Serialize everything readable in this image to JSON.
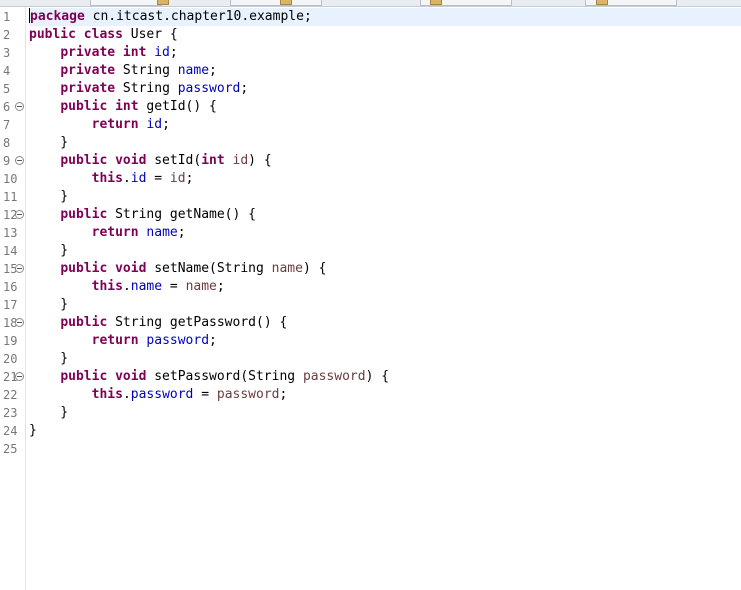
{
  "editor": {
    "lines": [
      {
        "n": "1",
        "fold": false,
        "tokens": [
          {
            "t": "package",
            "k": "kw"
          },
          {
            "t": " cn.itcast.chapter10.example;",
            "k": ""
          }
        ]
      },
      {
        "n": "2",
        "fold": false,
        "tokens": [
          {
            "t": "public class",
            "k": "kw"
          },
          {
            "t": " User {",
            "k": ""
          }
        ]
      },
      {
        "n": "3",
        "fold": false,
        "tokens": [
          {
            "t": "    ",
            "k": ""
          },
          {
            "t": "private int",
            "k": "kw"
          },
          {
            "t": " ",
            "k": ""
          },
          {
            "t": "id",
            "k": "fld"
          },
          {
            "t": ";",
            "k": ""
          }
        ]
      },
      {
        "n": "4",
        "fold": false,
        "tokens": [
          {
            "t": "    ",
            "k": ""
          },
          {
            "t": "private",
            "k": "kw"
          },
          {
            "t": " String ",
            "k": ""
          },
          {
            "t": "name",
            "k": "fld"
          },
          {
            "t": ";",
            "k": ""
          }
        ]
      },
      {
        "n": "5",
        "fold": false,
        "tokens": [
          {
            "t": "    ",
            "k": ""
          },
          {
            "t": "private",
            "k": "kw"
          },
          {
            "t": " String ",
            "k": ""
          },
          {
            "t": "password",
            "k": "fld"
          },
          {
            "t": ";",
            "k": ""
          }
        ]
      },
      {
        "n": "6",
        "fold": true,
        "tokens": [
          {
            "t": "    ",
            "k": ""
          },
          {
            "t": "public int",
            "k": "kw"
          },
          {
            "t": " getId() {",
            "k": ""
          }
        ]
      },
      {
        "n": "7",
        "fold": false,
        "tokens": [
          {
            "t": "        ",
            "k": ""
          },
          {
            "t": "return",
            "k": "kw"
          },
          {
            "t": " ",
            "k": ""
          },
          {
            "t": "id",
            "k": "fld"
          },
          {
            "t": ";",
            "k": ""
          }
        ]
      },
      {
        "n": "8",
        "fold": false,
        "tokens": [
          {
            "t": "    }",
            "k": ""
          }
        ]
      },
      {
        "n": "9",
        "fold": true,
        "tokens": [
          {
            "t": "    ",
            "k": ""
          },
          {
            "t": "public void",
            "k": "kw"
          },
          {
            "t": " setId(",
            "k": ""
          },
          {
            "t": "int",
            "k": "kw"
          },
          {
            "t": " ",
            "k": ""
          },
          {
            "t": "id",
            "k": "prm"
          },
          {
            "t": ") {",
            "k": ""
          }
        ]
      },
      {
        "n": "10",
        "fold": false,
        "tokens": [
          {
            "t": "        ",
            "k": ""
          },
          {
            "t": "this",
            "k": "kw"
          },
          {
            "t": ".",
            "k": ""
          },
          {
            "t": "id",
            "k": "fld"
          },
          {
            "t": " = ",
            "k": ""
          },
          {
            "t": "id",
            "k": "prm"
          },
          {
            "t": ";",
            "k": ""
          }
        ]
      },
      {
        "n": "11",
        "fold": false,
        "tokens": [
          {
            "t": "    }",
            "k": ""
          }
        ]
      },
      {
        "n": "12",
        "fold": true,
        "tokens": [
          {
            "t": "    ",
            "k": ""
          },
          {
            "t": "public",
            "k": "kw"
          },
          {
            "t": " String getName() {",
            "k": ""
          }
        ]
      },
      {
        "n": "13",
        "fold": false,
        "tokens": [
          {
            "t": "        ",
            "k": ""
          },
          {
            "t": "return",
            "k": "kw"
          },
          {
            "t": " ",
            "k": ""
          },
          {
            "t": "name",
            "k": "fld"
          },
          {
            "t": ";",
            "k": ""
          }
        ]
      },
      {
        "n": "14",
        "fold": false,
        "tokens": [
          {
            "t": "    }",
            "k": ""
          }
        ]
      },
      {
        "n": "15",
        "fold": true,
        "tokens": [
          {
            "t": "    ",
            "k": ""
          },
          {
            "t": "public void",
            "k": "kw"
          },
          {
            "t": " setName(String ",
            "k": ""
          },
          {
            "t": "name",
            "k": "prm"
          },
          {
            "t": ") {",
            "k": ""
          }
        ]
      },
      {
        "n": "16",
        "fold": false,
        "tokens": [
          {
            "t": "        ",
            "k": ""
          },
          {
            "t": "this",
            "k": "kw"
          },
          {
            "t": ".",
            "k": ""
          },
          {
            "t": "name",
            "k": "fld"
          },
          {
            "t": " = ",
            "k": ""
          },
          {
            "t": "name",
            "k": "prm"
          },
          {
            "t": ";",
            "k": ""
          }
        ]
      },
      {
        "n": "17",
        "fold": false,
        "tokens": [
          {
            "t": "    }",
            "k": ""
          }
        ]
      },
      {
        "n": "18",
        "fold": true,
        "tokens": [
          {
            "t": "    ",
            "k": ""
          },
          {
            "t": "public",
            "k": "kw"
          },
          {
            "t": " String getPassword() {",
            "k": ""
          }
        ]
      },
      {
        "n": "19",
        "fold": false,
        "tokens": [
          {
            "t": "        ",
            "k": ""
          },
          {
            "t": "return",
            "k": "kw"
          },
          {
            "t": " ",
            "k": ""
          },
          {
            "t": "password",
            "k": "fld"
          },
          {
            "t": ";",
            "k": ""
          }
        ]
      },
      {
        "n": "20",
        "fold": false,
        "tokens": [
          {
            "t": "    }",
            "k": ""
          }
        ]
      },
      {
        "n": "21",
        "fold": true,
        "tokens": [
          {
            "t": "    ",
            "k": ""
          },
          {
            "t": "public void",
            "k": "kw"
          },
          {
            "t": " setPassword(String ",
            "k": ""
          },
          {
            "t": "password",
            "k": "prm"
          },
          {
            "t": ") {",
            "k": ""
          }
        ]
      },
      {
        "n": "22",
        "fold": false,
        "tokens": [
          {
            "t": "        ",
            "k": ""
          },
          {
            "t": "this",
            "k": "kw"
          },
          {
            "t": ".",
            "k": ""
          },
          {
            "t": "password",
            "k": "fld"
          },
          {
            "t": " = ",
            "k": ""
          },
          {
            "t": "password",
            "k": "prm"
          },
          {
            "t": ";",
            "k": ""
          }
        ]
      },
      {
        "n": "23",
        "fold": false,
        "tokens": [
          {
            "t": "    }",
            "k": ""
          }
        ]
      },
      {
        "n": "24",
        "fold": false,
        "tokens": [
          {
            "t": "}",
            "k": ""
          }
        ]
      },
      {
        "n": "25",
        "fold": false,
        "tokens": []
      }
    ]
  },
  "colors": {
    "keyword": "#7f0055",
    "field": "#0000c0",
    "parameter": "#6a3e3e",
    "line_number": "#787878",
    "current_line": "#e8f2fe"
  }
}
